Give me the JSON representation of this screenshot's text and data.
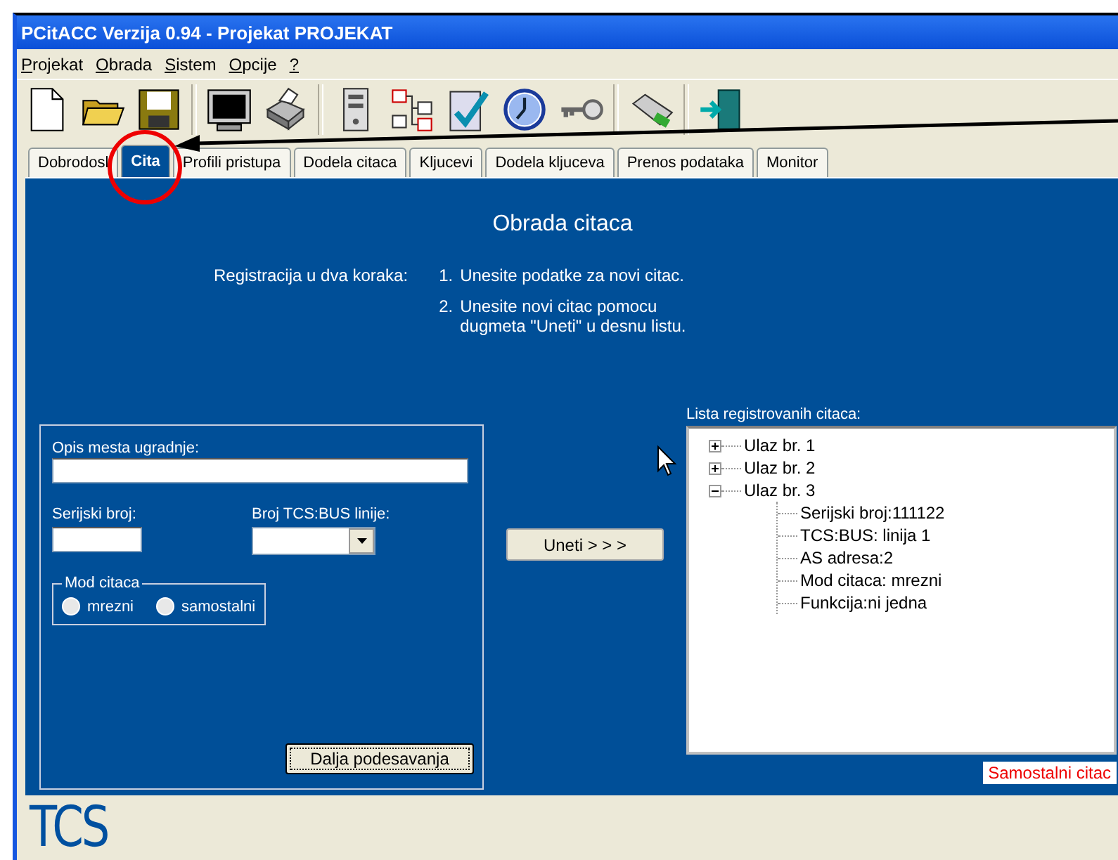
{
  "window": {
    "title": "PCitACC Verzija 0.94 - Projekat PROJEKAT"
  },
  "menu": [
    "Projekat",
    "Obrada",
    "Sistem",
    "Opcije",
    "?"
  ],
  "tabs": [
    {
      "label": "Dobrodosl",
      "selected": false
    },
    {
      "label": "Cita",
      "selected": true
    },
    {
      "label": "Profili pristupa",
      "selected": false
    },
    {
      "label": "Dodela citaca",
      "selected": false
    },
    {
      "label": "Kljucevi",
      "selected": false
    },
    {
      "label": "Dodela kljuceva",
      "selected": false
    },
    {
      "label": "Prenos podataka",
      "selected": false
    },
    {
      "label": "Monitor",
      "selected": false
    }
  ],
  "page": {
    "title": "Obrada citaca",
    "steps_label": "Registracija u dva koraka:",
    "steps": [
      {
        "number": "1.",
        "text": "Unesite podatke za novi citac."
      },
      {
        "number": "2.",
        "text": "Unesite novi citac pomocu dugmeta \"Uneti\" u desnu listu."
      }
    ]
  },
  "form": {
    "location_label": "Opis mesta ugradnje:",
    "serial_label": "Serijski broj:",
    "bus_label": "Broj TCS:BUS linije:",
    "mode_group": "Mod citaca",
    "modes": [
      {
        "label": "mrezni",
        "checked": false
      },
      {
        "label": "samostalni",
        "checked": false
      }
    ],
    "more_button": "Dalja podesavanja"
  },
  "add_button": "Uneti > > >",
  "reader_list": {
    "label": "Lista registrovanih citaca:",
    "items": [
      {
        "label": "Ulaz br. 1",
        "expanded": false
      },
      {
        "label": "Ulaz br. 2",
        "expanded": false
      },
      {
        "label": "Ulaz br. 3",
        "expanded": true,
        "children": [
          {
            "label": "Serijski broj:111122"
          },
          {
            "label": "TCS:BUS: linija 1"
          },
          {
            "label": "AS adresa:2"
          },
          {
            "label": "Mod citaca: mrezni"
          },
          {
            "label": "Funkcija:ni jedna"
          }
        ]
      }
    ]
  },
  "status": "Samostalni citac",
  "logo": "TCS"
}
